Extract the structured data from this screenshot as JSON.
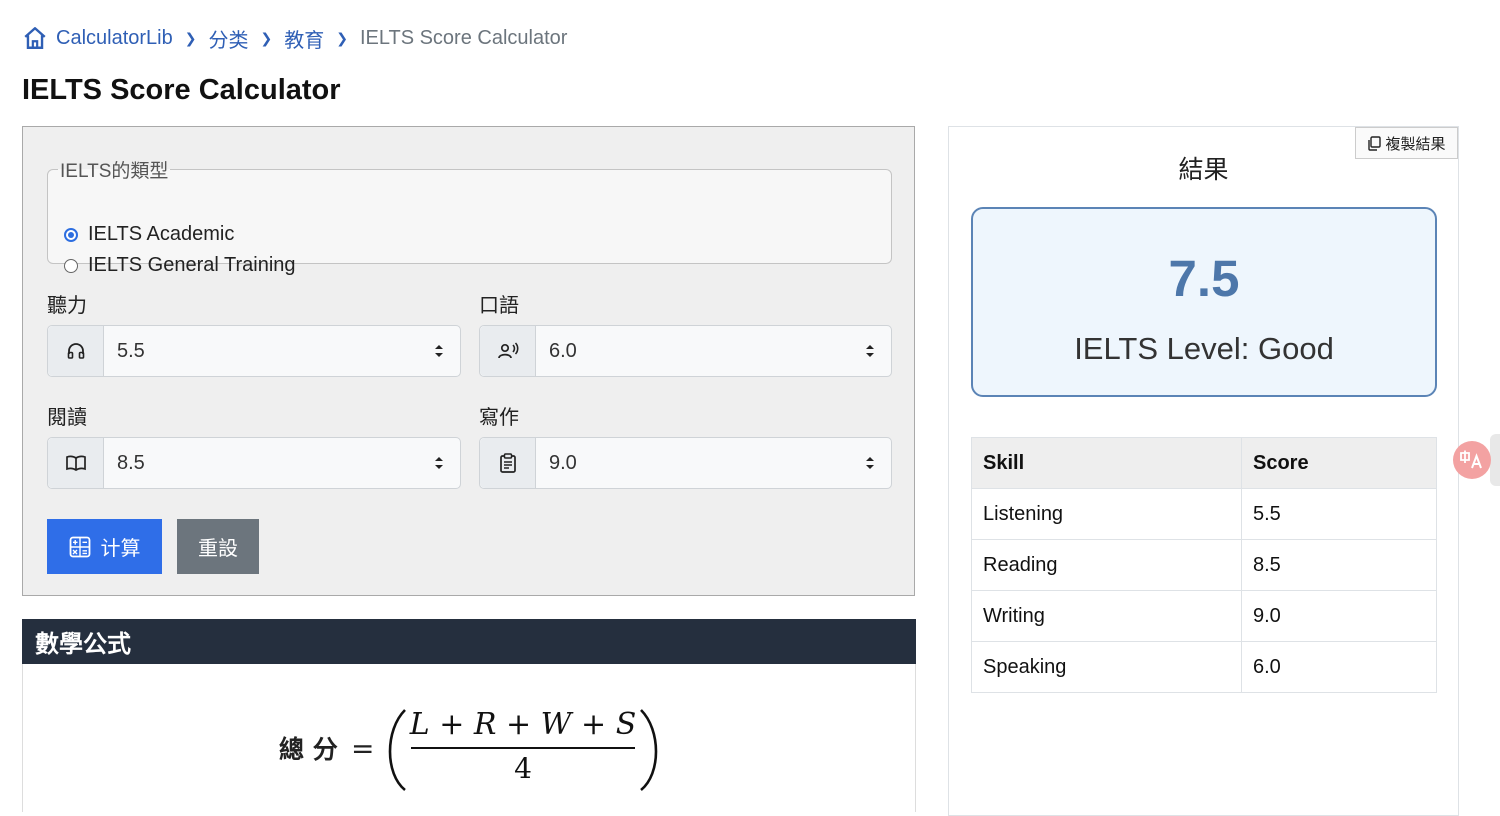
{
  "breadcrumb": {
    "home": "CalculatorLib",
    "items": [
      "分类",
      "教育"
    ],
    "current": "IELTS Score Calculator"
  },
  "page_title": "IELTS Score Calculator",
  "form": {
    "type_legend": "IELTS的類型",
    "type_options": [
      {
        "label": "IELTS Academic",
        "selected": true
      },
      {
        "label": "IELTS General Training",
        "selected": false
      }
    ],
    "fields": {
      "listening": {
        "label": "聽力",
        "value": "5.5",
        "icon": "headphones-icon"
      },
      "speaking": {
        "label": "口語",
        "value": "6.0",
        "icon": "speaking-person-icon"
      },
      "reading": {
        "label": "閱讀",
        "value": "8.5",
        "icon": "book-icon"
      },
      "writing": {
        "label": "寫作",
        "value": "9.0",
        "icon": "clipboard-icon"
      }
    },
    "calculate_label": "计算",
    "reset_label": "重設"
  },
  "formula": {
    "header": "數學公式",
    "lhs": "總 分",
    "numerator": "L + R + W + S",
    "denominator": "4"
  },
  "result": {
    "copy_label": "複製結果",
    "title": "結果",
    "score": "7.5",
    "level": "IELTS Level: Good",
    "table": {
      "headers": [
        "Skill",
        "Score"
      ],
      "rows": [
        [
          "Listening",
          "5.5"
        ],
        [
          "Reading",
          "8.5"
        ],
        [
          "Writing",
          "9.0"
        ],
        [
          "Speaking",
          "6.0"
        ]
      ]
    }
  },
  "colors": {
    "link": "#2f5fb5",
    "primary_button": "#2f6ee8",
    "secondary_button": "#6c757d",
    "formula_header_bg": "#252f3e",
    "score_accent": "#4d77aa",
    "score_box_bg": "#eef6fd"
  }
}
